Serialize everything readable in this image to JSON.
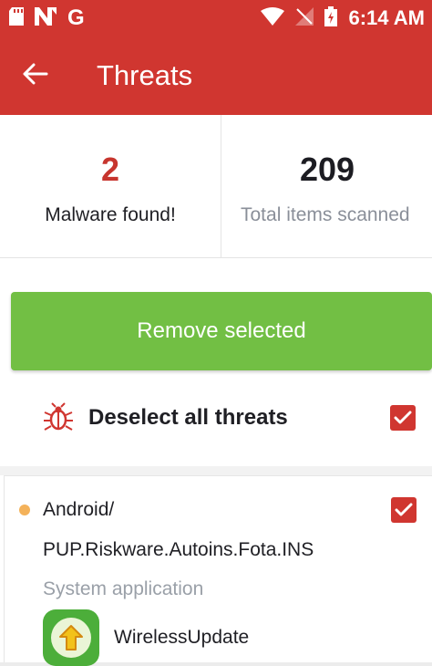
{
  "status_bar": {
    "left_icons": [
      "sd-card-icon",
      "n-notification-icon",
      "google-icon"
    ],
    "google_glyph": "G",
    "right_icons": [
      "wifi-icon",
      "no-signal-icon",
      "battery-charging-icon"
    ],
    "time": "6:14 AM"
  },
  "app_bar": {
    "title": "Threats",
    "back_icon": "arrow-left-icon"
  },
  "stats": {
    "malware_count": "2",
    "malware_label": "Malware found!",
    "scanned_count": "209",
    "scanned_label": "Total items scanned"
  },
  "actions": {
    "remove_label": "Remove selected",
    "deselect_label": "Deselect all threats",
    "deselect_checked": true
  },
  "threats": [
    {
      "name_line1": "Android/",
      "name_line2": "PUP.Riskware.Autoins.Fota.INS",
      "type": "System application",
      "app_name": "WirelessUpdate",
      "checked": true,
      "severity_color": "#f4b25a"
    }
  ],
  "colors": {
    "brand_red": "#d03630",
    "action_green": "#72bf44",
    "count_red": "#c7352e"
  }
}
